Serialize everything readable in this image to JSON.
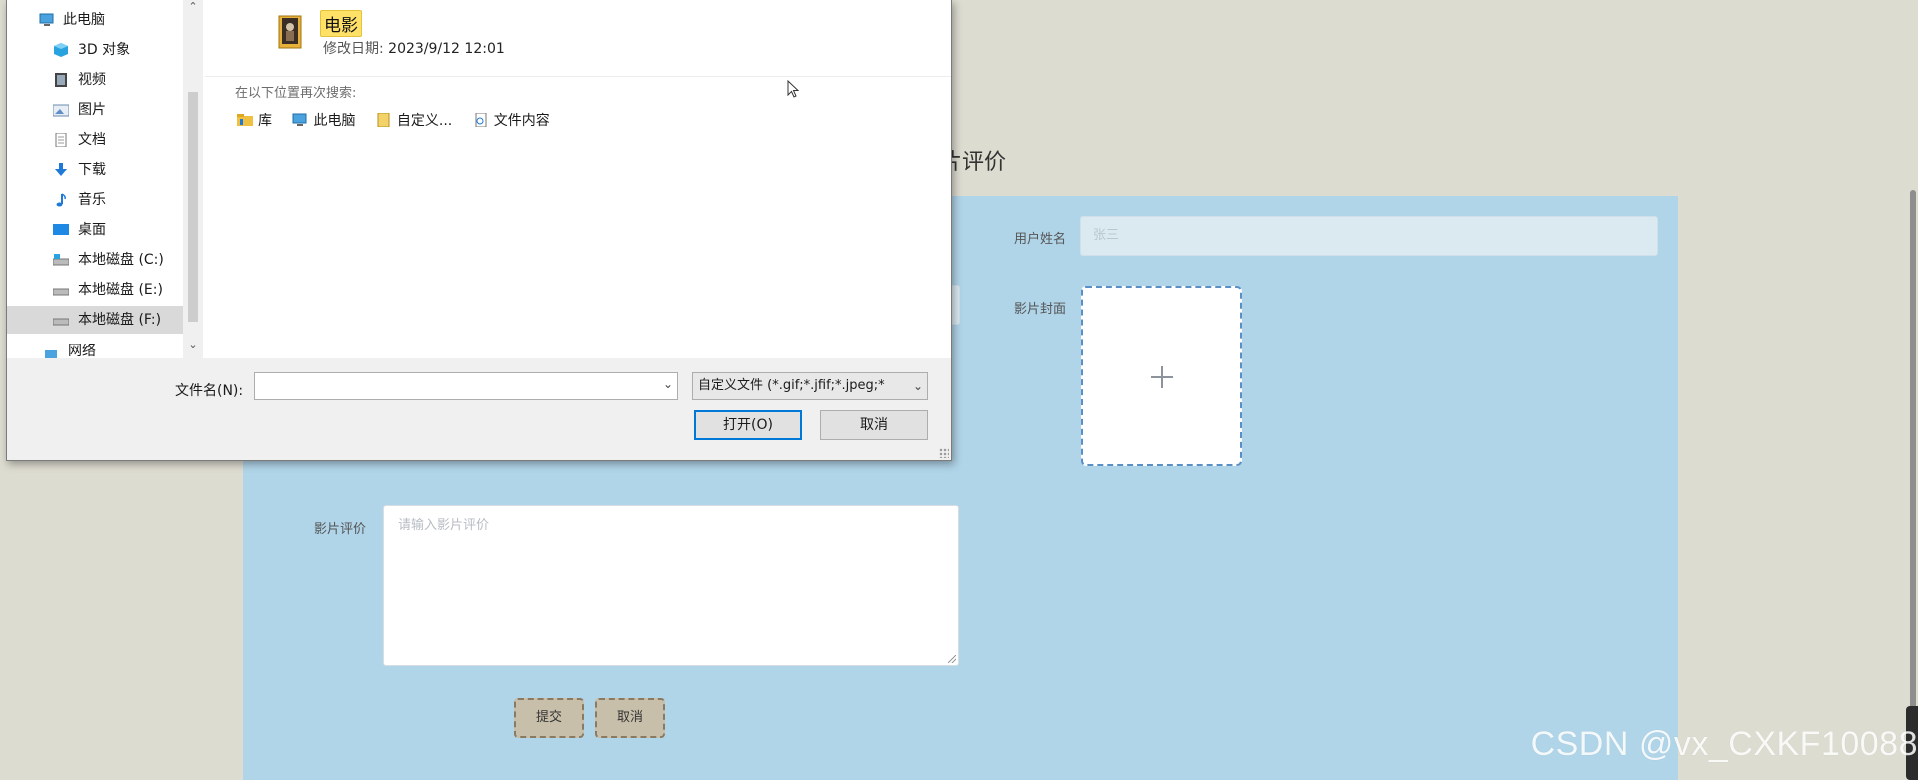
{
  "page": {
    "heading": "片评价",
    "username_label": "用户姓名",
    "username_value": "张三",
    "cover_label": "影片封面",
    "review_label": "影片评价",
    "review_placeholder": "请输入影片评价",
    "submit_label": "提交",
    "cancel_label": "取消",
    "watermark": "CSDN @vx_CXKF10088"
  },
  "dialog": {
    "nav_items": [
      {
        "label": "此电脑",
        "icon": "computer-icon"
      },
      {
        "label": "3D 对象",
        "icon": "cube-3d-icon"
      },
      {
        "label": "视频",
        "icon": "video-icon"
      },
      {
        "label": "图片",
        "icon": "pictures-icon"
      },
      {
        "label": "文档",
        "icon": "document-icon"
      },
      {
        "label": "下载",
        "icon": "download-icon"
      },
      {
        "label": "音乐",
        "icon": "music-icon"
      },
      {
        "label": "桌面",
        "icon": "desktop-icon"
      },
      {
        "label": "本地磁盘 (C:)",
        "icon": "drive-c-icon"
      },
      {
        "label": "本地磁盘 (E:)",
        "icon": "drive-icon"
      },
      {
        "label": "本地磁盘 (F:)",
        "icon": "drive-icon",
        "selected": true
      },
      {
        "label": "网络",
        "icon": "network-icon"
      }
    ],
    "result": {
      "name": "电影",
      "meta_label": "修改日期:",
      "meta_value": "2023/9/12 12:01"
    },
    "search_again_label": "在以下位置再次搜索:",
    "search_links": [
      {
        "label": "库",
        "icon": "library-icon"
      },
      {
        "label": "此电脑",
        "icon": "computer-icon"
      },
      {
        "label": "自定义...",
        "icon": "custom-folder-icon"
      },
      {
        "label": "文件内容",
        "icon": "file-content-icon"
      }
    ],
    "filename_label": "文件名(N):",
    "filename_value": "",
    "filter_value": "自定义文件 (*.gif;*.jfif;*.jpeg;*",
    "open_label": "打开(O)",
    "cancel_label": "取消"
  },
  "colors": {
    "panel_bg": "#b0d4e8",
    "page_bg": "#dddcd0",
    "highlight": "#ffe168",
    "focus_blue": "#0078d7"
  }
}
